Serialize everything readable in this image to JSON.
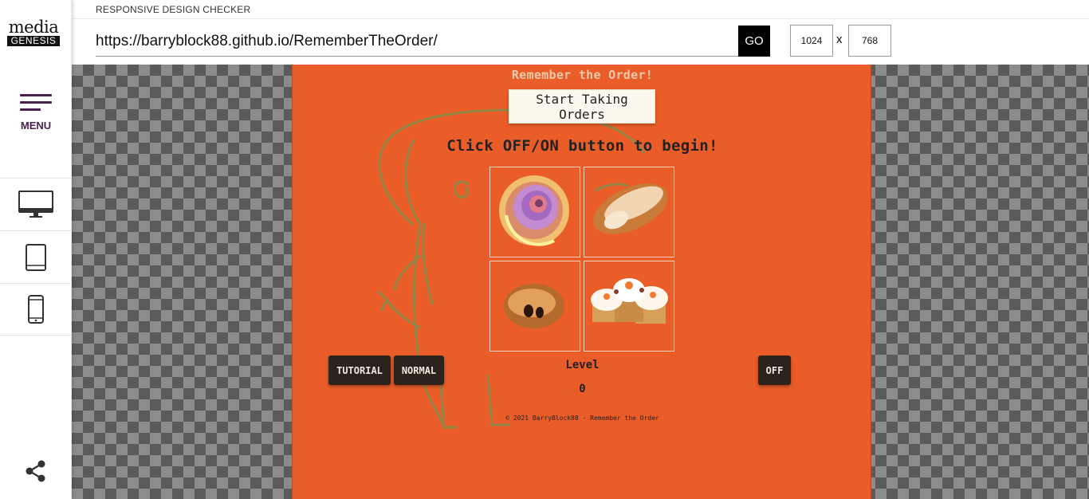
{
  "sidebar": {
    "logo_top": "media",
    "logo_bottom": "GENESIS",
    "menu_label": "MENU",
    "devices": [
      {
        "name": "desktop-icon"
      },
      {
        "name": "tablet-icon"
      },
      {
        "name": "phone-icon"
      }
    ],
    "share_icon": "share-icon",
    "accent": "#4a1e4f"
  },
  "header": {
    "title": "RESPONSIVE DESIGN CHECKER",
    "url": "https://barryblock88.github.io/RememberTheOrder/",
    "go_label": "GO",
    "width": "1024",
    "x_label": "x",
    "height": "768"
  },
  "game": {
    "title": "Remember the Order!",
    "start_label": "Start Taking Orders",
    "instruction": "Click OFF/ON button to begin!",
    "tiles": [
      {
        "name": "cinnamon-roll-tile"
      },
      {
        "name": "bread-roll-tile"
      },
      {
        "name": "chocolate-croissant-tile"
      },
      {
        "name": "cupcakes-tile"
      }
    ],
    "tutorial_label": "TUTORIAL",
    "normal_label": "NORMAL",
    "power_label": "OFF",
    "level_label": "Level",
    "level_value": "0",
    "footer": "© 2021 BarryBlock88 - Remember the Order",
    "background": "#ea5d29"
  }
}
